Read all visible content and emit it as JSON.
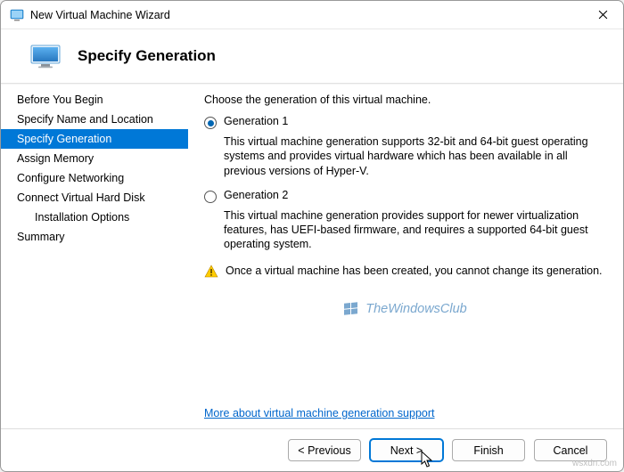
{
  "titlebar": {
    "title": "New Virtual Machine Wizard"
  },
  "header": {
    "title": "Specify Generation"
  },
  "sidebar": {
    "items": [
      {
        "label": "Before You Begin"
      },
      {
        "label": "Specify Name and Location"
      },
      {
        "label": "Specify Generation"
      },
      {
        "label": "Assign Memory"
      },
      {
        "label": "Configure Networking"
      },
      {
        "label": "Connect Virtual Hard Disk"
      },
      {
        "label": "Installation Options"
      },
      {
        "label": "Summary"
      }
    ]
  },
  "content": {
    "intro": "Choose the generation of this virtual machine.",
    "gen1_label": "Generation 1",
    "gen1_desc": "This virtual machine generation supports 32-bit and 64-bit guest operating systems and provides virtual hardware which has been available in all previous versions of Hyper-V.",
    "gen2_label": "Generation 2",
    "gen2_desc": "This virtual machine generation provides support for newer virtualization features, has UEFI-based firmware, and requires a supported 64-bit guest operating system.",
    "warning": "Once a virtual machine has been created, you cannot change its generation.",
    "link": "More about virtual machine generation support"
  },
  "watermark": {
    "text": "TheWindowsClub"
  },
  "footer": {
    "previous": "< Previous",
    "next": "Next >",
    "finish": "Finish",
    "cancel": "Cancel"
  },
  "attribution": "wsxdn.com"
}
